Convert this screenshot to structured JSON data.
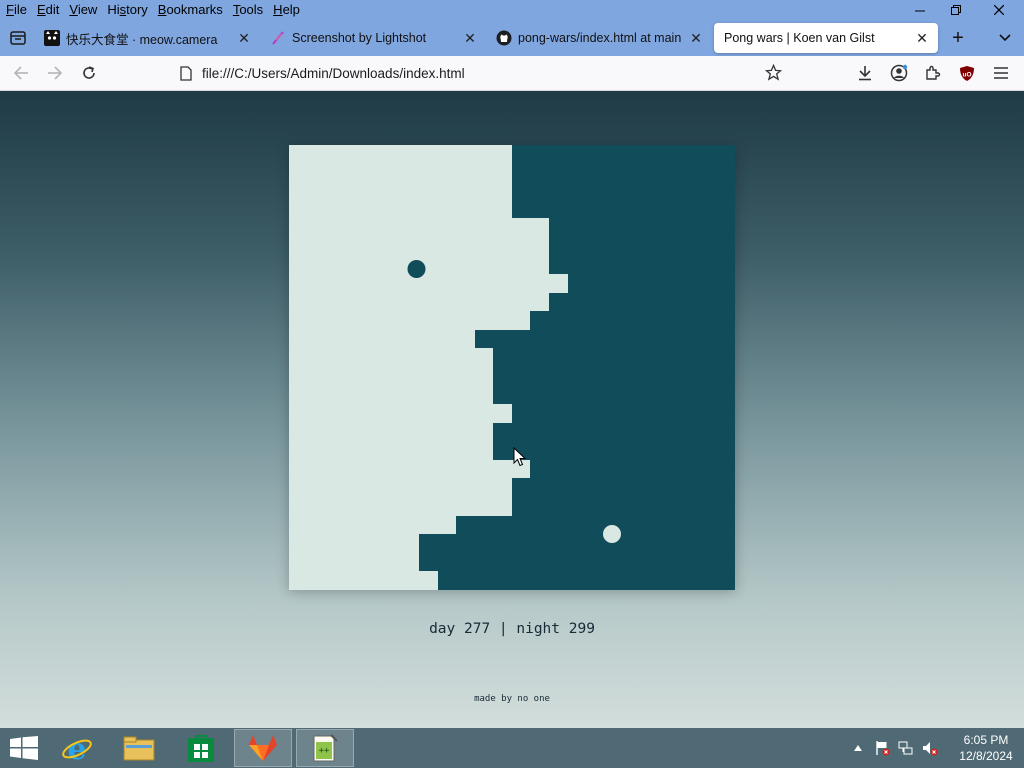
{
  "menu": [
    {
      "accel": "F",
      "rest": "ile"
    },
    {
      "accel": "E",
      "rest": "dit"
    },
    {
      "accel": "V",
      "rest": "iew"
    },
    {
      "accel": "",
      "pre": "Hi",
      "accel2": "s",
      "rest": "tory"
    },
    {
      "accel": "B",
      "rest": "ookmarks"
    },
    {
      "accel": "T",
      "rest": "ools"
    },
    {
      "accel": "H",
      "rest": "elp"
    }
  ],
  "menu_labels": [
    "File",
    "Edit",
    "View",
    "History",
    "Bookmarks",
    "Tools",
    "Help"
  ],
  "tabs": [
    {
      "title": "快乐大食堂 · meow.camera",
      "icon": "cat-favicon-icon",
      "active": false
    },
    {
      "title": "Screenshot by Lightshot",
      "icon": "lightshot-feather-icon",
      "active": false
    },
    {
      "title": "pong-wars/index.html at main",
      "icon": "github-icon",
      "active": false
    },
    {
      "title": "Pong wars | Koen van Gilst",
      "icon": "",
      "active": true
    }
  ],
  "navbar": {
    "url": "file:///C:/Users/Admin/Downloads/index.html"
  },
  "page": {
    "score_text": "day 277 | night 299",
    "made_by": "made by no one"
  },
  "colors": {
    "day": "#d9e8e3",
    "night": "#114c5a",
    "menubar": "#7fa6df"
  },
  "taskbar": {
    "apps": [
      "internet-explorer-icon",
      "file-explorer-icon",
      "store-icon",
      "gitlab-icon",
      "notepadpp-icon"
    ],
    "clock_time": "6:05 PM",
    "clock_date": "12/8/2024"
  }
}
